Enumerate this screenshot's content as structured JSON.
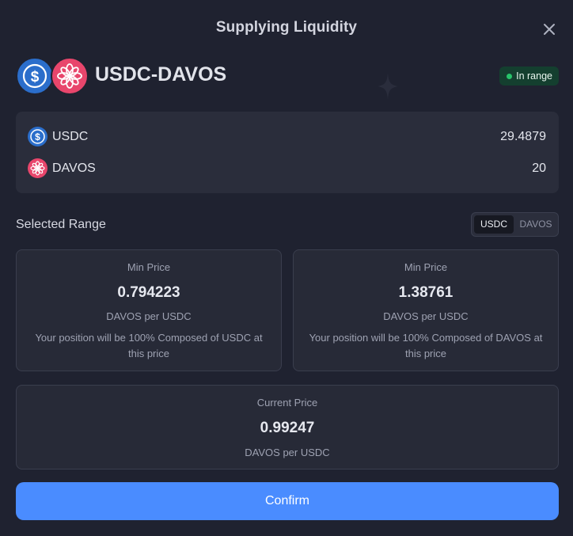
{
  "modal": {
    "title": "Supplying Liquidity",
    "close_icon": "close-icon"
  },
  "pair": {
    "name": "USDC-DAVOS",
    "status": "In range",
    "status_color": "#27c46a",
    "tokens": [
      {
        "symbol": "USDC",
        "color": "#2b6ecb",
        "icon": "usdc-icon"
      },
      {
        "symbol": "DAVOS",
        "color": "#e8466c",
        "icon": "davos-icon"
      }
    ]
  },
  "amounts": [
    {
      "token": "USDC",
      "value": "29.4879"
    },
    {
      "token": "DAVOS",
      "value": "20"
    }
  ],
  "range": {
    "title": "Selected Range",
    "toggle": {
      "active": "USDC",
      "inactive": "DAVOS"
    },
    "min_left": {
      "label": "Min Price",
      "value": "0.794223",
      "unit": "DAVOS per USDC",
      "note": "Your position will be 100% Composed of USDC at this price"
    },
    "min_right": {
      "label": "Min Price",
      "value": "1.38761",
      "unit": "DAVOS per USDC",
      "note": "Your position will be 100% Composed of DAVOS at this price"
    },
    "current": {
      "label": "Current Price",
      "value": "0.99247",
      "unit": "DAVOS per USDC"
    }
  },
  "confirm_label": "Confirm",
  "accent_color": "#4a8cff"
}
